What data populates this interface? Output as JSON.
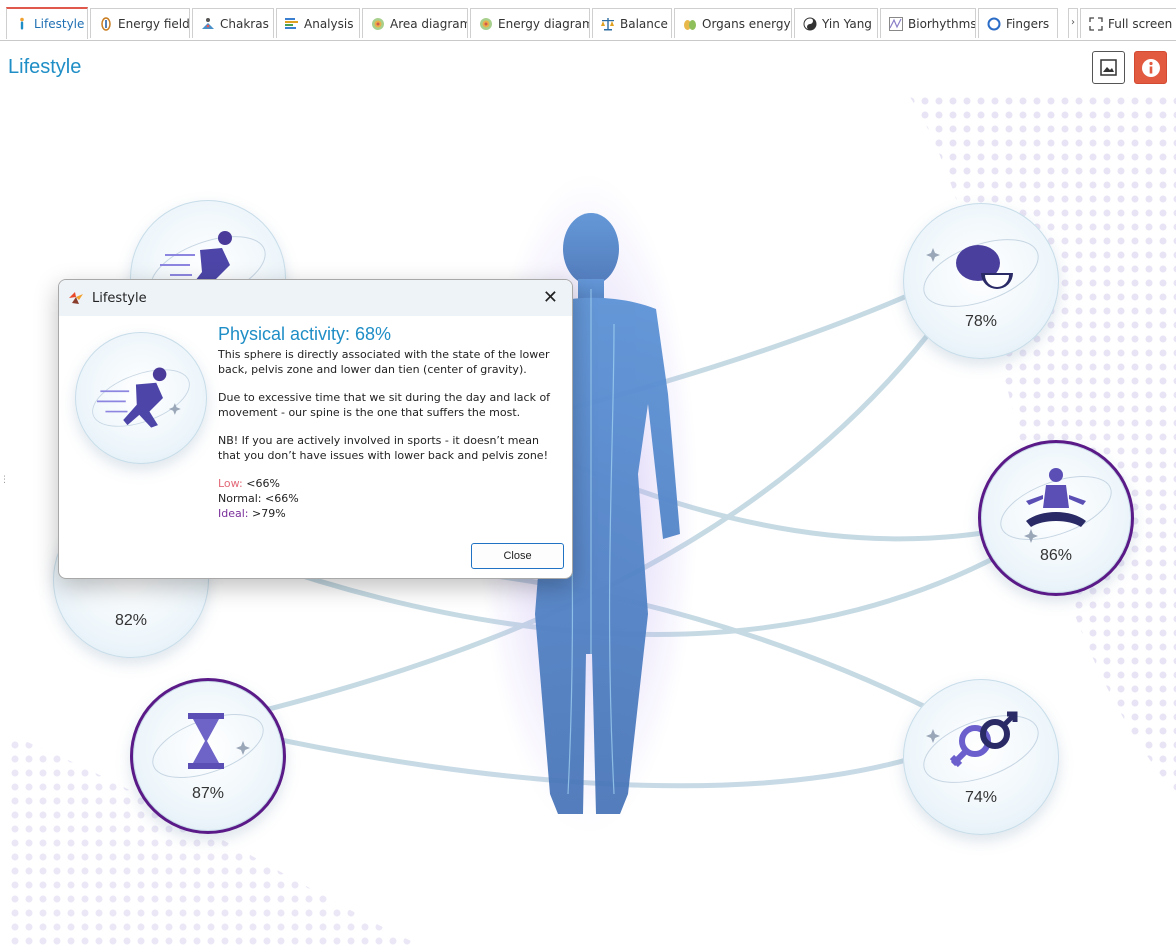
{
  "tabs": [
    {
      "label": "Lifestyle",
      "icon": "person-icon"
    },
    {
      "label": "Energy field",
      "icon": "energy-field-icon"
    },
    {
      "label": "Chakras",
      "icon": "chakras-icon"
    },
    {
      "label": "Analysis",
      "icon": "analysis-icon"
    },
    {
      "label": "Area diagram",
      "icon": "area-diagram-icon"
    },
    {
      "label": "Energy diagram",
      "icon": "energy-diagram-icon"
    },
    {
      "label": "Balance",
      "icon": "balance-icon"
    },
    {
      "label": "Organs energy",
      "icon": "organs-icon"
    },
    {
      "label": "Yin Yang",
      "icon": "yin-yang-icon"
    },
    {
      "label": "Biorhythms",
      "icon": "biorhythms-icon"
    },
    {
      "label": "Fingers",
      "icon": "fingers-icon"
    }
  ],
  "overflow_glyph": "›",
  "fullscreen_label": "Full screen",
  "page_title": "Lifestyle",
  "spheres": {
    "activity": {
      "pct": "",
      "icon": "runner-icon"
    },
    "left_middle": {
      "pct": "82%",
      "icon": "unknown-icon"
    },
    "time": {
      "pct": "87%",
      "icon": "hourglass-icon"
    },
    "nutrition": {
      "pct": "78%",
      "icon": "lemon-icon"
    },
    "meditation": {
      "pct": "86%",
      "icon": "meditation-icon"
    },
    "sexuality": {
      "pct": "74%",
      "icon": "gender-icon"
    }
  },
  "dialog": {
    "window_title": "Lifestyle",
    "close_glyph": "✕",
    "heading": "Physical activity: 68%",
    "paragraphs": [
      "This sphere is directly associated with the state of the lower back, pelvis zone and lower dan tien (center of gravity).",
      "Due to excessive time that we sit during the day and lack of movement - our spine is the one that suffers the most.",
      "NB! If you are actively involved in sports - it doesn’t mean that you don’t have issues with lower back and pelvis zone!"
    ],
    "levels": {
      "low_label": "Low:",
      "low_value": "<66%",
      "normal_label": "Normal:",
      "normal_value": "<66%",
      "ideal_label": "Ideal:",
      "ideal_value": ">79%"
    },
    "close_button": "Close"
  },
  "colors": {
    "accent_blue": "#1f8ec6",
    "highlight_purple": "#5a1a87",
    "info_red": "#e25a3f",
    "low_pink": "#e36a79",
    "ideal_purple": "#7a2f9a"
  }
}
